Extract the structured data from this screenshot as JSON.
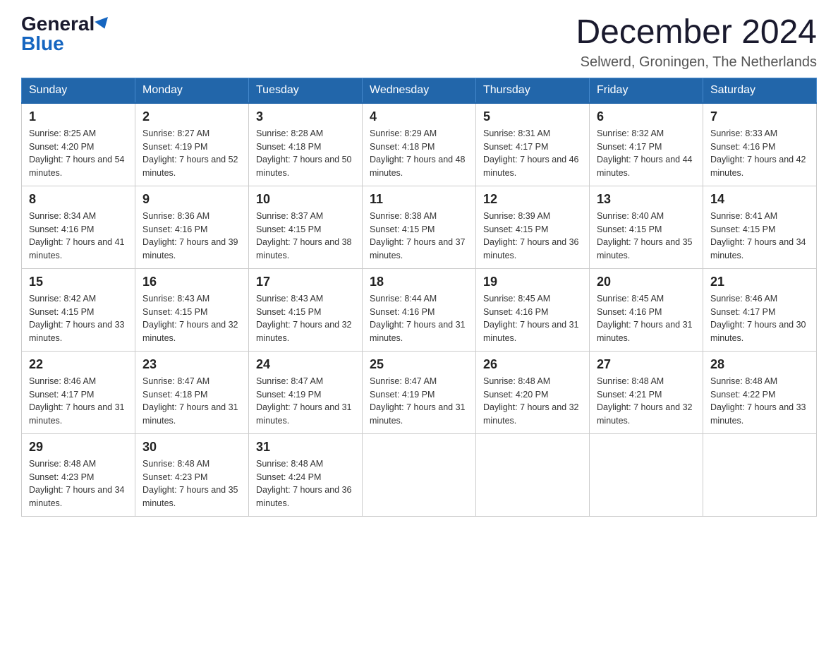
{
  "logo": {
    "general": "General",
    "blue": "Blue"
  },
  "header": {
    "month": "December 2024",
    "location": "Selwerd, Groningen, The Netherlands"
  },
  "weekdays": [
    "Sunday",
    "Monday",
    "Tuesday",
    "Wednesday",
    "Thursday",
    "Friday",
    "Saturday"
  ],
  "weeks": [
    [
      {
        "day": "1",
        "sunrise": "8:25 AM",
        "sunset": "4:20 PM",
        "daylight": "7 hours and 54 minutes."
      },
      {
        "day": "2",
        "sunrise": "8:27 AM",
        "sunset": "4:19 PM",
        "daylight": "7 hours and 52 minutes."
      },
      {
        "day": "3",
        "sunrise": "8:28 AM",
        "sunset": "4:18 PM",
        "daylight": "7 hours and 50 minutes."
      },
      {
        "day": "4",
        "sunrise": "8:29 AM",
        "sunset": "4:18 PM",
        "daylight": "7 hours and 48 minutes."
      },
      {
        "day": "5",
        "sunrise": "8:31 AM",
        "sunset": "4:17 PM",
        "daylight": "7 hours and 46 minutes."
      },
      {
        "day": "6",
        "sunrise": "8:32 AM",
        "sunset": "4:17 PM",
        "daylight": "7 hours and 44 minutes."
      },
      {
        "day": "7",
        "sunrise": "8:33 AM",
        "sunset": "4:16 PM",
        "daylight": "7 hours and 42 minutes."
      }
    ],
    [
      {
        "day": "8",
        "sunrise": "8:34 AM",
        "sunset": "4:16 PM",
        "daylight": "7 hours and 41 minutes."
      },
      {
        "day": "9",
        "sunrise": "8:36 AM",
        "sunset": "4:16 PM",
        "daylight": "7 hours and 39 minutes."
      },
      {
        "day": "10",
        "sunrise": "8:37 AM",
        "sunset": "4:15 PM",
        "daylight": "7 hours and 38 minutes."
      },
      {
        "day": "11",
        "sunrise": "8:38 AM",
        "sunset": "4:15 PM",
        "daylight": "7 hours and 37 minutes."
      },
      {
        "day": "12",
        "sunrise": "8:39 AM",
        "sunset": "4:15 PM",
        "daylight": "7 hours and 36 minutes."
      },
      {
        "day": "13",
        "sunrise": "8:40 AM",
        "sunset": "4:15 PM",
        "daylight": "7 hours and 35 minutes."
      },
      {
        "day": "14",
        "sunrise": "8:41 AM",
        "sunset": "4:15 PM",
        "daylight": "7 hours and 34 minutes."
      }
    ],
    [
      {
        "day": "15",
        "sunrise": "8:42 AM",
        "sunset": "4:15 PM",
        "daylight": "7 hours and 33 minutes."
      },
      {
        "day": "16",
        "sunrise": "8:43 AM",
        "sunset": "4:15 PM",
        "daylight": "7 hours and 32 minutes."
      },
      {
        "day": "17",
        "sunrise": "8:43 AM",
        "sunset": "4:15 PM",
        "daylight": "7 hours and 32 minutes."
      },
      {
        "day": "18",
        "sunrise": "8:44 AM",
        "sunset": "4:16 PM",
        "daylight": "7 hours and 31 minutes."
      },
      {
        "day": "19",
        "sunrise": "8:45 AM",
        "sunset": "4:16 PM",
        "daylight": "7 hours and 31 minutes."
      },
      {
        "day": "20",
        "sunrise": "8:45 AM",
        "sunset": "4:16 PM",
        "daylight": "7 hours and 31 minutes."
      },
      {
        "day": "21",
        "sunrise": "8:46 AM",
        "sunset": "4:17 PM",
        "daylight": "7 hours and 30 minutes."
      }
    ],
    [
      {
        "day": "22",
        "sunrise": "8:46 AM",
        "sunset": "4:17 PM",
        "daylight": "7 hours and 31 minutes."
      },
      {
        "day": "23",
        "sunrise": "8:47 AM",
        "sunset": "4:18 PM",
        "daylight": "7 hours and 31 minutes."
      },
      {
        "day": "24",
        "sunrise": "8:47 AM",
        "sunset": "4:19 PM",
        "daylight": "7 hours and 31 minutes."
      },
      {
        "day": "25",
        "sunrise": "8:47 AM",
        "sunset": "4:19 PM",
        "daylight": "7 hours and 31 minutes."
      },
      {
        "day": "26",
        "sunrise": "8:48 AM",
        "sunset": "4:20 PM",
        "daylight": "7 hours and 32 minutes."
      },
      {
        "day": "27",
        "sunrise": "8:48 AM",
        "sunset": "4:21 PM",
        "daylight": "7 hours and 32 minutes."
      },
      {
        "day": "28",
        "sunrise": "8:48 AM",
        "sunset": "4:22 PM",
        "daylight": "7 hours and 33 minutes."
      }
    ],
    [
      {
        "day": "29",
        "sunrise": "8:48 AM",
        "sunset": "4:23 PM",
        "daylight": "7 hours and 34 minutes."
      },
      {
        "day": "30",
        "sunrise": "8:48 AM",
        "sunset": "4:23 PM",
        "daylight": "7 hours and 35 minutes."
      },
      {
        "day": "31",
        "sunrise": "8:48 AM",
        "sunset": "4:24 PM",
        "daylight": "7 hours and 36 minutes."
      },
      null,
      null,
      null,
      null
    ]
  ]
}
